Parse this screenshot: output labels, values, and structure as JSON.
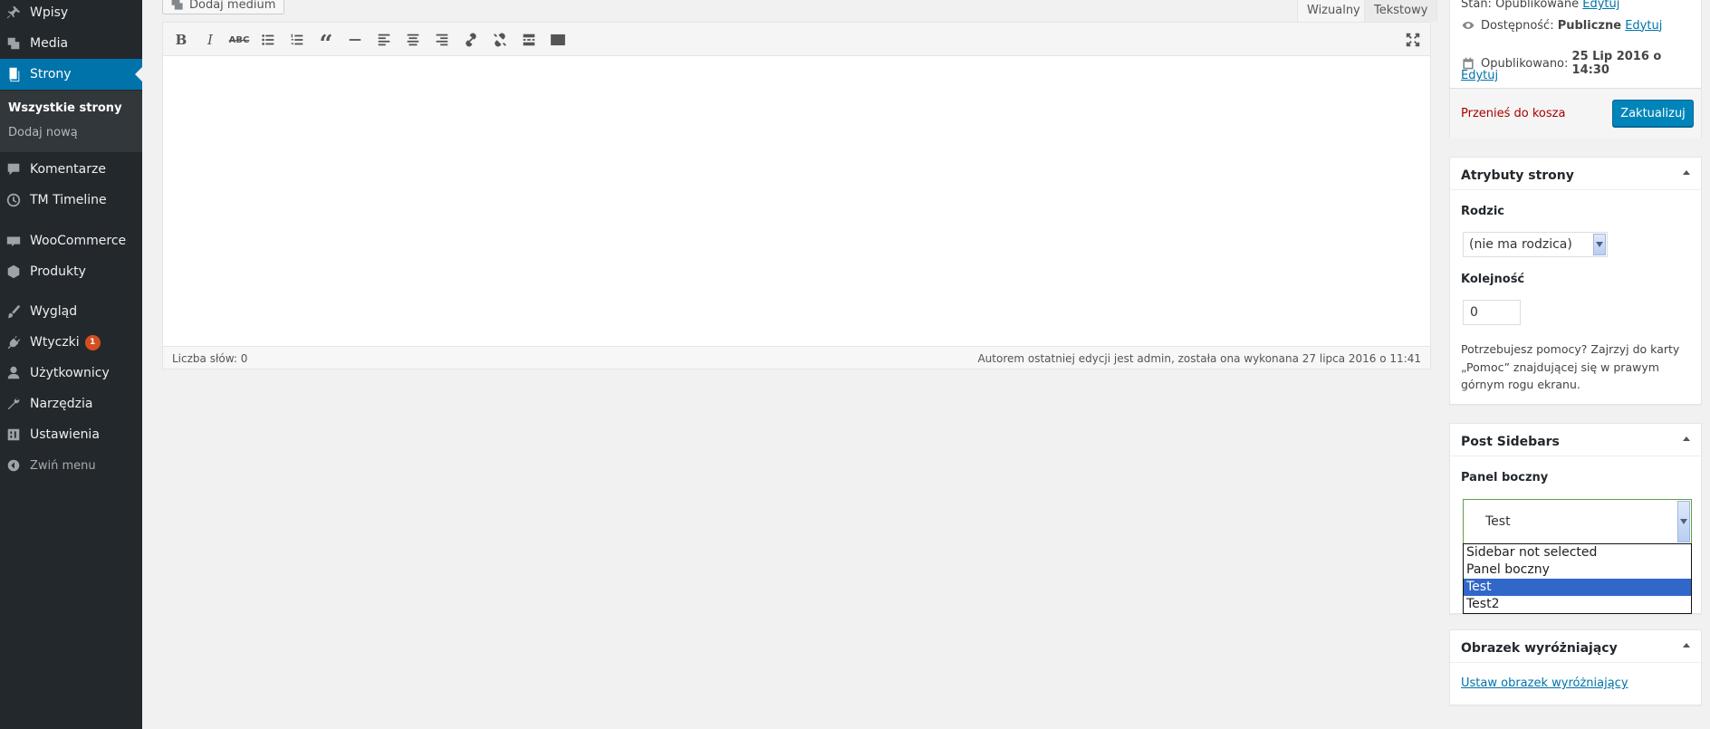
{
  "sidebar": {
    "items": [
      {
        "label": "Wpisy",
        "icon": "pin-icon"
      },
      {
        "label": "Media",
        "icon": "media-icon"
      },
      {
        "label": "Strony",
        "icon": "pages-icon"
      },
      {
        "label": "Komentarze",
        "icon": "comments-icon"
      },
      {
        "label": "TM Timeline",
        "icon": "clock-icon"
      },
      {
        "label": "WooCommerce",
        "icon": "woo-icon"
      },
      {
        "label": "Produkty",
        "icon": "products-icon"
      },
      {
        "label": "Wygląd",
        "icon": "brush-icon"
      },
      {
        "label": "Wtyczki",
        "icon": "plugin-icon",
        "badge": "1"
      },
      {
        "label": "Użytkownicy",
        "icon": "users-icon"
      },
      {
        "label": "Narzędzia",
        "icon": "wrench-icon"
      },
      {
        "label": "Ustawienia",
        "icon": "settings-icon"
      }
    ],
    "submenu": [
      "Wszystkie strony",
      "Dodaj nową"
    ],
    "collapse": "Zwiń menu"
  },
  "editor": {
    "add_media": "Dodaj medium",
    "tab_visual": "Wizualny",
    "tab_text": "Tekstowy",
    "toolbar": [
      "bold-icon",
      "italic-icon",
      "strikethrough-icon",
      "bullet-list-icon",
      "numbered-list-icon",
      "blockquote-icon",
      "horizontal-rule-icon",
      "align-left-icon",
      "align-center-icon",
      "align-right-icon",
      "link-icon",
      "unlink-icon",
      "read-more-icon",
      "toolbar-toggle-icon"
    ],
    "word_count": "Liczba słów: 0",
    "last_edit": "Autorem ostatniej edycji jest admin, została ona wykonana 27 lipca 2016 o 11:41"
  },
  "publish": {
    "status_label": "Stan: Opublikowane",
    "status_edit": "Edytuj",
    "visibility_label": "Dostępność:",
    "visibility_value": "Publiczne",
    "visibility_edit": "Edytuj",
    "published_label": "Opublikowano:",
    "published_value": "25 Lip 2016 o 14:30",
    "published_edit": "Edytuj",
    "trash": "Przenieś do kosza",
    "update": "Zaktualizuj"
  },
  "attributes": {
    "title": "Atrybuty strony",
    "parent_label": "Rodzic",
    "parent_value": "(nie ma rodzica)",
    "order_label": "Kolejność",
    "order_value": "0",
    "help": [
      "Potrzebujesz pomocy? Zajrzyj do karty",
      "„Pomoc” znajdującej się w prawym",
      "górnym rogu ekranu."
    ]
  },
  "post_sidebars": {
    "title": "Post Sidebars",
    "label": "Panel boczny",
    "selected": "Test",
    "options": [
      "Sidebar not selected",
      "Panel boczny",
      "Test",
      "Test2"
    ]
  },
  "featured": {
    "title": "Obrazek wyróżniający",
    "link": "Ustaw obrazek wyróżniający"
  },
  "colors": {
    "accent": "#0073aa",
    "sidebar_bg": "#23282d",
    "trash": "#a00"
  }
}
